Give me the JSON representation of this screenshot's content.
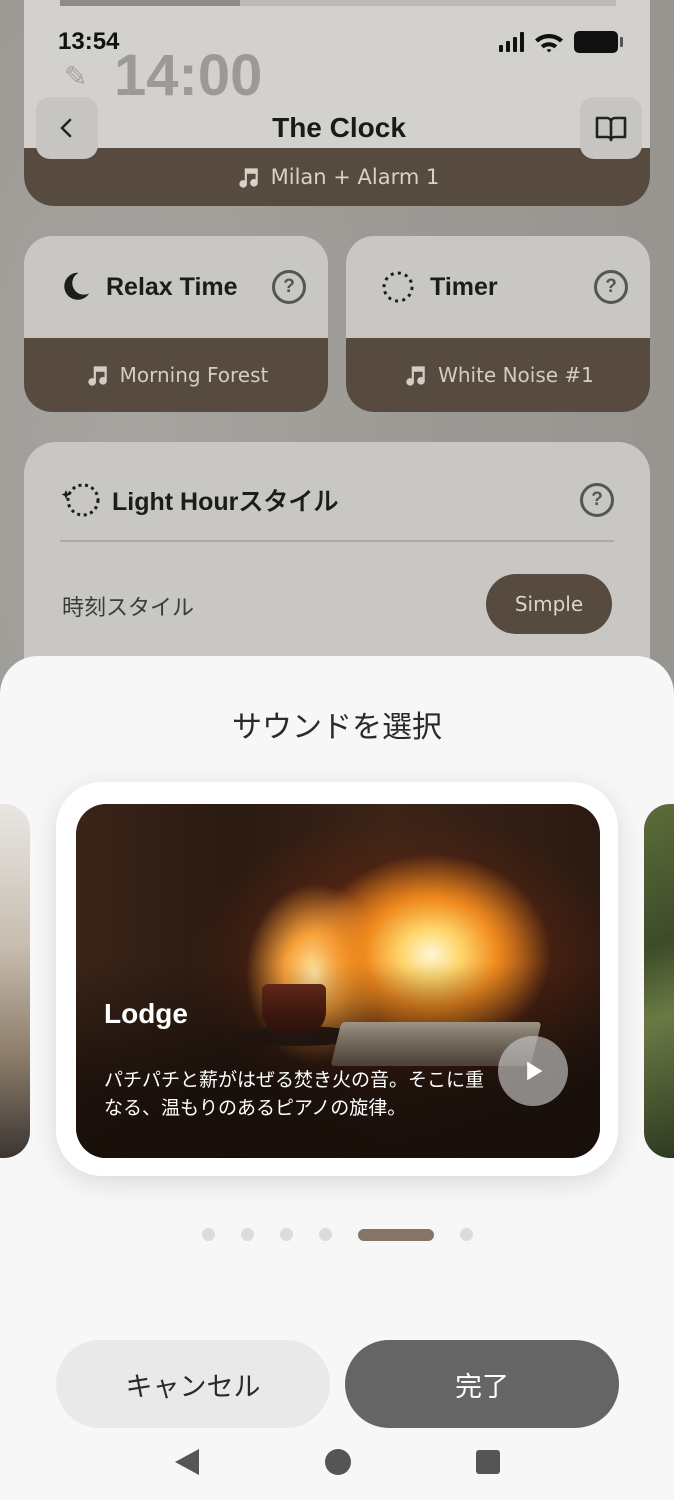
{
  "status_bar": {
    "time": "13:54"
  },
  "background": {
    "top_card": {
      "ghost_time": "14:00",
      "sound_label": "Milan + Alarm 1"
    },
    "header": {
      "title": "The Clock"
    },
    "relax_card": {
      "title": "Relax Time",
      "help": "?",
      "sound_label": "Morning Forest"
    },
    "timer_card": {
      "title": "Timer",
      "help": "?",
      "sound_label": "White Noise #1"
    },
    "light_hour_card": {
      "title": "Light Hourスタイル",
      "help": "?",
      "row_label": "時刻スタイル",
      "style_value": "Simple"
    }
  },
  "sheet": {
    "title": "サウンドを選択",
    "current_sound": {
      "name": "Lodge",
      "description": "パチパチと薪がはぜる焚き火の音。そこに重なる、温もりのあるピアノの旋律。"
    },
    "pagination": {
      "total": 6,
      "active_index": 4
    },
    "cancel_label": "キャンセル",
    "done_label": "完了"
  },
  "colors": {
    "accent_brown": "#574a3f",
    "dot_active": "#857566",
    "done_button": "#656565",
    "sheet_bg": "#f7f7f7"
  }
}
